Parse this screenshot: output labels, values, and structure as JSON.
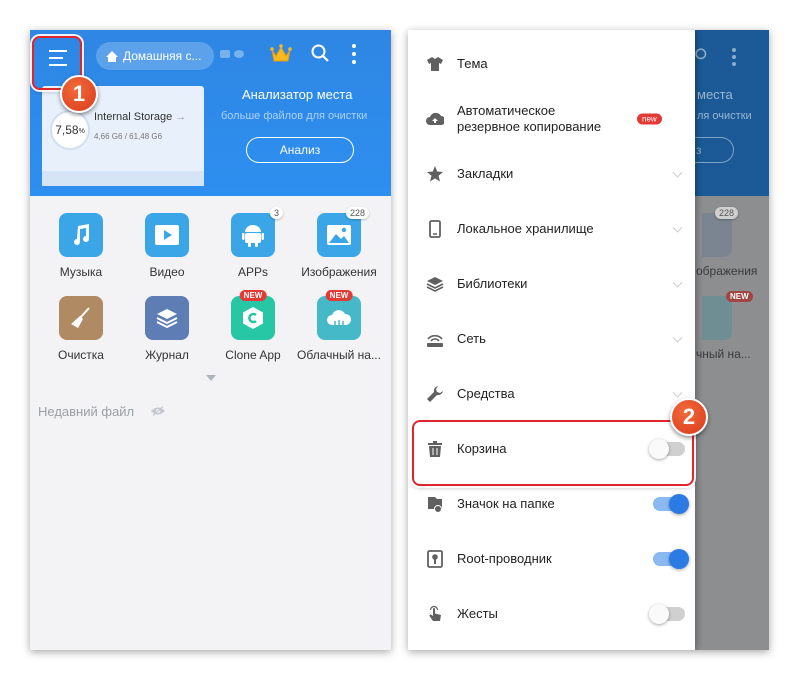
{
  "left_screen": {
    "header": {
      "breadcrumb": "Домашняя с...",
      "storage": {
        "percent": "7,58",
        "percent_unit": "%",
        "title": "Internal Storage",
        "arrow": "→",
        "size": "4,66 G6 / 61,48 G6"
      },
      "analyzer": {
        "title": "Анализатор места",
        "subtitle": "больше файлов для очистки",
        "button": "Анализ"
      }
    },
    "grid": [
      {
        "label": "Музыка",
        "icon": "music-icon",
        "color": "#3aa6e8"
      },
      {
        "label": "Видео",
        "icon": "video-icon",
        "color": "#3aa6e8"
      },
      {
        "label": "APPs",
        "icon": "android-icon",
        "color": "#3aa6e8",
        "badge": "3"
      },
      {
        "label": "Изображения",
        "icon": "image-icon",
        "color": "#3aa6e8",
        "badge": "228"
      },
      {
        "label": "Очистка",
        "icon": "broom-icon",
        "color": "#b08a63"
      },
      {
        "label": "Журнал",
        "icon": "journal-icon",
        "color": "#5d7db4"
      },
      {
        "label": "Clone App",
        "icon": "clone-icon",
        "color": "#27c6a4",
        "new": "NEW"
      },
      {
        "label": "Облачный на...",
        "icon": "cloud-icon",
        "color": "#46b9c8",
        "new": "NEW"
      }
    ],
    "recent": {
      "label": "Недавний файл"
    }
  },
  "right_screen": {
    "background_text": {
      "analyzer_fragment": "места",
      "subtitle_fragment": "ля очистки",
      "button_fragment": "з",
      "images_fragment": "ображения",
      "images_badge": "228",
      "cloud_fragment": "чный на...",
      "cloud_new": "NEW"
    },
    "drawer": [
      {
        "label": "Тема",
        "icon": "shirt-icon"
      },
      {
        "label": "Автоматическое\nрезервное копирование",
        "icon": "cloud-backup-icon",
        "new_tag": "new"
      },
      {
        "label": "Закладки",
        "icon": "star-icon",
        "chevron": true
      },
      {
        "label": "Локальное хранилище",
        "icon": "phone-icon",
        "chevron": true
      },
      {
        "label": "Библиотеки",
        "icon": "layers-icon",
        "chevron": true
      },
      {
        "label": "Сеть",
        "icon": "network-icon",
        "chevron": true
      },
      {
        "label": "Средства",
        "icon": "wrench-icon",
        "chevron": true
      },
      {
        "label": "Корзина",
        "icon": "trash-icon",
        "toggle": "off"
      },
      {
        "label": "Значок на папке",
        "icon": "folder-badge-icon",
        "toggle": "on"
      },
      {
        "label": "Root-проводник",
        "icon": "root-icon",
        "toggle": "on"
      },
      {
        "label": "Жесты",
        "icon": "gesture-icon",
        "toggle": "off"
      }
    ]
  },
  "annotations": {
    "step1": "1",
    "step2": "2",
    "highlight_color": "#e0262c",
    "badge_color": "#e4502a"
  },
  "colors": {
    "header_blue": "#2d8ff0",
    "toggle_on": "#2a7be4",
    "new_red": "#e33a35"
  }
}
